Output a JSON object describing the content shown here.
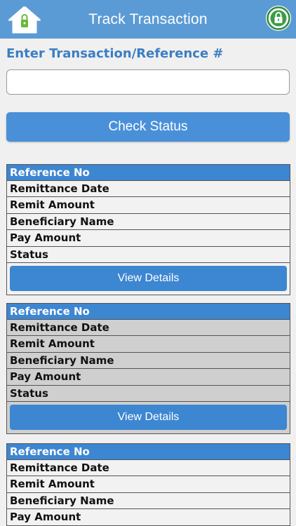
{
  "header": {
    "title": "Track Transaction",
    "home_icon": "home-lock-icon",
    "lock_icon": "lock-icon",
    "accent": "#5b9bd5"
  },
  "form": {
    "label": "Enter Transaction/Reference #",
    "input_value": "",
    "input_placeholder": "",
    "check_button": "Check Status"
  },
  "cards": [
    {
      "theme": "white",
      "header": "Reference No",
      "rows": [
        "Remittance Date",
        "Remit Amount",
        "Beneficiary Name",
        "Pay Amount",
        "Status"
      ],
      "button": "View Details"
    },
    {
      "theme": "grey",
      "header": "Reference No",
      "rows": [
        "Remittance Date",
        "Remit Amount",
        "Beneficiary Name",
        "Pay Amount",
        "Status"
      ],
      "button": "View Details"
    },
    {
      "theme": "white",
      "header": "Reference No",
      "rows": [
        "Remittance Date",
        "Remit Amount",
        "Beneficiary Name",
        "Pay Amount"
      ],
      "button": ""
    }
  ],
  "colors": {
    "header_blue": "#5b9bd5",
    "button_blue": "#4a90d9",
    "card_header_blue": "#3d86d1",
    "label_blue": "#3a7ec4",
    "grey_row": "#cfcfcf"
  }
}
